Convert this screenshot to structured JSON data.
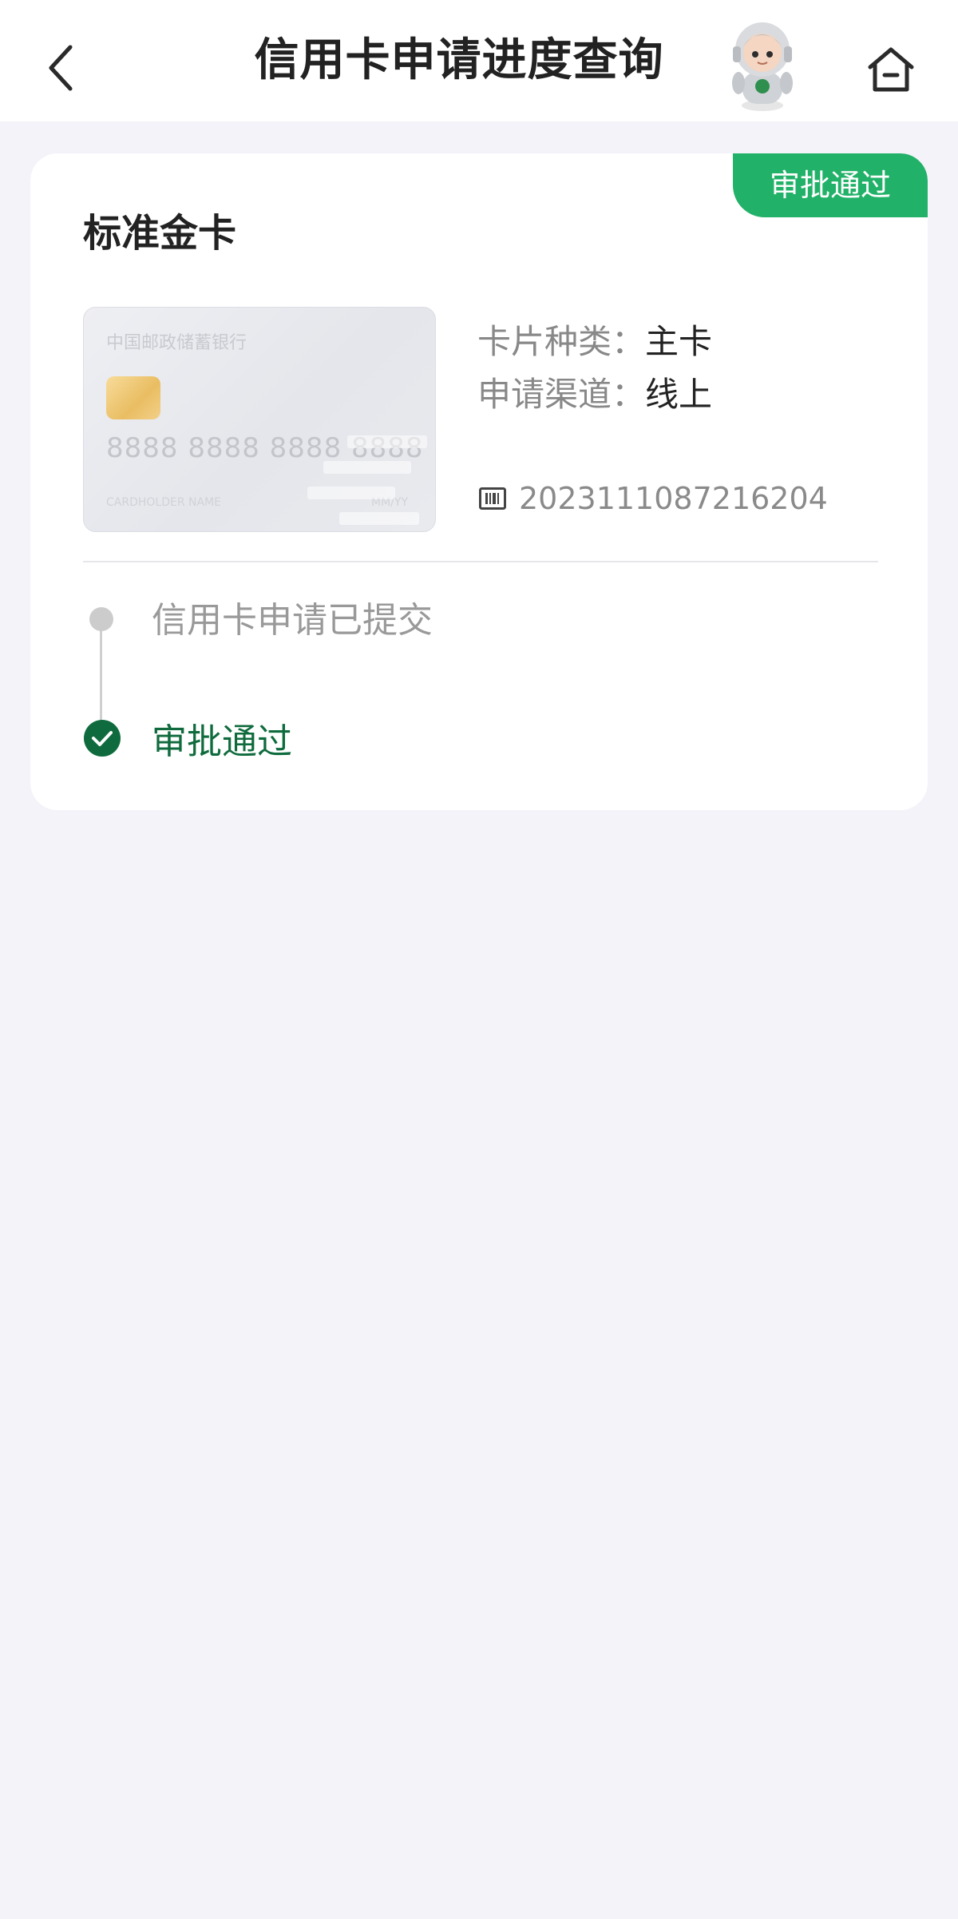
{
  "header": {
    "title": "信用卡申请进度查询",
    "back_icon": "chevron-left-icon",
    "mascot_icon": "robot-mascot-icon",
    "home_icon": "home-icon"
  },
  "application": {
    "status_badge": "审批通过",
    "card_name": "标准金卡",
    "card_image": {
      "bank_name": "中国邮政储蓄银行",
      "card_number": "8888 8888 8888 8888",
      "holder_label": "CARDHOLDER NAME",
      "expiry_label": "MM/YY"
    },
    "card_type_label": "卡片种类：",
    "card_type_value": "主卡",
    "channel_label": "申请渠道：",
    "channel_value": "线上",
    "application_number": "2023111087216204"
  },
  "timeline": {
    "steps": [
      {
        "label": "信用卡申请已提交",
        "state": "done"
      },
      {
        "label": "审批通过",
        "state": "current"
      }
    ]
  },
  "colors": {
    "accent_green": "#22b168",
    "dark_green": "#0f6b3d",
    "background": "#f3f3f9"
  }
}
